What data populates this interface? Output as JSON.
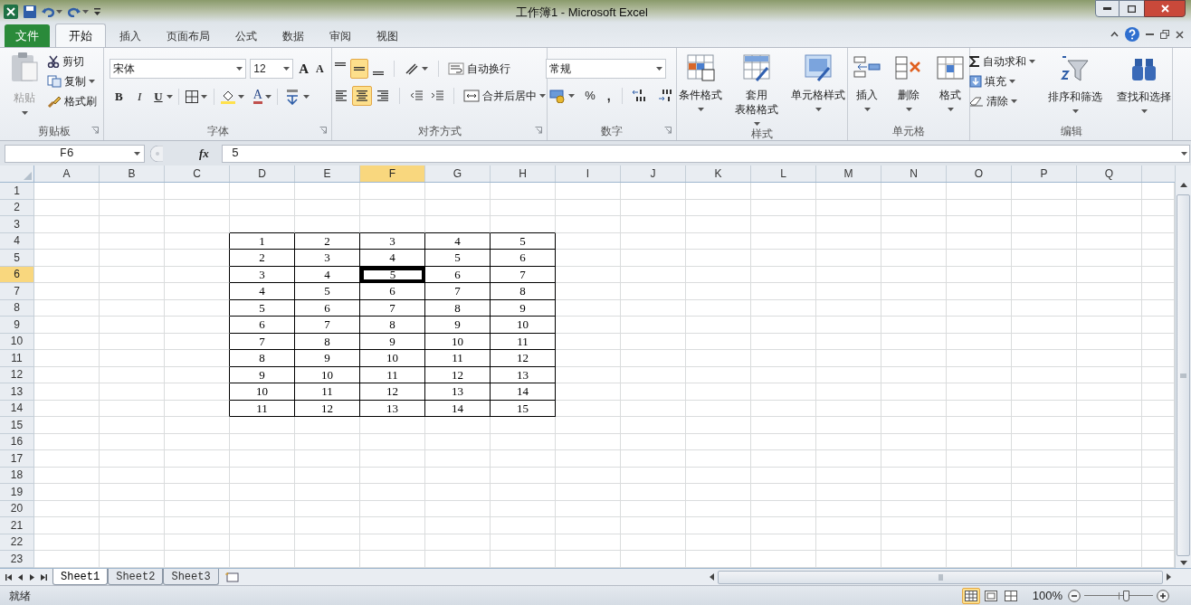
{
  "window": {
    "title": "工作簿1 - Microsoft Excel"
  },
  "ribbon_tabs": [
    {
      "label": "文件",
      "kind": "file",
      "selected": false
    },
    {
      "label": "开始",
      "kind": "tab",
      "selected": true
    },
    {
      "label": "插入",
      "kind": "tab",
      "selected": false
    },
    {
      "label": "页面布局",
      "kind": "tab",
      "selected": false
    },
    {
      "label": "公式",
      "kind": "tab",
      "selected": false
    },
    {
      "label": "数据",
      "kind": "tab",
      "selected": false
    },
    {
      "label": "审阅",
      "kind": "tab",
      "selected": false
    },
    {
      "label": "视图",
      "kind": "tab",
      "selected": false
    }
  ],
  "ribbon_groups": [
    {
      "kind": "clipboard",
      "label": "剪贴板",
      "paste": "粘贴",
      "items": [
        "剪切",
        "复制",
        "格式刷"
      ]
    },
    {
      "kind": "font",
      "label": "字体",
      "font": "宋体",
      "size": "12",
      "grow": "A",
      "shrink": "A",
      "bold": "B",
      "italic": "I",
      "underline": "U",
      "font_color": "A"
    },
    {
      "kind": "alignment",
      "label": "对齐方式",
      "vertical": [
        {
          "selected": false
        },
        {
          "selected": true
        },
        {
          "selected": false
        }
      ],
      "horizontal": [
        {
          "selected": false
        },
        {
          "selected": true
        },
        {
          "selected": false
        }
      ],
      "wrap": "自动换行",
      "merge": "合并后居中"
    },
    {
      "kind": "number",
      "label": "数字",
      "format": "常规",
      "percent": "%",
      "comma": ","
    },
    {
      "kind": "styles",
      "label": "样式",
      "buttons": [
        {
          "lines": [
            "条件格式"
          ]
        },
        {
          "lines": [
            "套用",
            "表格格式"
          ]
        },
        {
          "lines": [
            "单元格样式"
          ]
        }
      ]
    },
    {
      "kind": "cells",
      "label": "单元格",
      "buttons": [
        {
          "lines": [
            "插入"
          ]
        },
        {
          "lines": [
            "删除"
          ]
        },
        {
          "lines": [
            "格式"
          ]
        }
      ]
    },
    {
      "kind": "editing",
      "label": "编辑",
      "small": [
        "自动求和",
        "填充",
        "清除"
      ],
      "large": [
        {
          "lines": [
            "排序和筛选"
          ]
        },
        {
          "lines": [
            "查找和选择"
          ]
        }
      ]
    }
  ],
  "formula_bar": {
    "name_box": "F6",
    "fx": "fx",
    "formula": "5"
  },
  "columns": [
    {
      "label": "A",
      "selected": false
    },
    {
      "label": "B",
      "selected": false
    },
    {
      "label": "C",
      "selected": false
    },
    {
      "label": "D",
      "selected": false
    },
    {
      "label": "E",
      "selected": false
    },
    {
      "label": "F",
      "selected": true
    },
    {
      "label": "G",
      "selected": false
    },
    {
      "label": "H",
      "selected": false
    },
    {
      "label": "I",
      "selected": false
    },
    {
      "label": "J",
      "selected": false
    },
    {
      "label": "K",
      "selected": false
    },
    {
      "label": "L",
      "selected": false
    },
    {
      "label": "M",
      "selected": false
    },
    {
      "label": "N",
      "selected": false
    },
    {
      "label": "O",
      "selected": false
    },
    {
      "label": "P",
      "selected": false
    },
    {
      "label": "Q",
      "selected": false
    }
  ],
  "rows": [
    {
      "label": "1",
      "selected": false
    },
    {
      "label": "2",
      "selected": false
    },
    {
      "label": "3",
      "selected": false
    },
    {
      "label": "4",
      "selected": false
    },
    {
      "label": "5",
      "selected": false
    },
    {
      "label": "6",
      "selected": true
    },
    {
      "label": "7",
      "selected": false
    },
    {
      "label": "8",
      "selected": false
    },
    {
      "label": "9",
      "selected": false
    },
    {
      "label": "10",
      "selected": false
    },
    {
      "label": "11",
      "selected": false
    },
    {
      "label": "12",
      "selected": false
    },
    {
      "label": "13",
      "selected": false
    },
    {
      "label": "14",
      "selected": false
    },
    {
      "label": "15",
      "selected": false
    },
    {
      "label": "16",
      "selected": false
    },
    {
      "label": "17",
      "selected": false
    },
    {
      "label": "18",
      "selected": false
    },
    {
      "label": "19",
      "selected": false
    },
    {
      "label": "20",
      "selected": false
    },
    {
      "label": "21",
      "selected": false
    },
    {
      "label": "22",
      "selected": false
    },
    {
      "label": "23",
      "selected": false
    }
  ],
  "table": [
    [
      {
        "value": "1",
        "selected": false
      },
      {
        "value": "2",
        "selected": false
      },
      {
        "value": "3",
        "selected": false
      },
      {
        "value": "4",
        "selected": false
      },
      {
        "value": "5",
        "selected": false
      }
    ],
    [
      {
        "value": "2",
        "selected": false
      },
      {
        "value": "3",
        "selected": false
      },
      {
        "value": "4",
        "selected": false
      },
      {
        "value": "5",
        "selected": false
      },
      {
        "value": "6",
        "selected": false
      }
    ],
    [
      {
        "value": "3",
        "selected": false
      },
      {
        "value": "4",
        "selected": false
      },
      {
        "value": "5",
        "selected": true
      },
      {
        "value": "6",
        "selected": false
      },
      {
        "value": "7",
        "selected": false
      }
    ],
    [
      {
        "value": "4",
        "selected": false
      },
      {
        "value": "5",
        "selected": false
      },
      {
        "value": "6",
        "selected": false
      },
      {
        "value": "7",
        "selected": false
      },
      {
        "value": "8",
        "selected": false
      }
    ],
    [
      {
        "value": "5",
        "selected": false
      },
      {
        "value": "6",
        "selected": false
      },
      {
        "value": "7",
        "selected": false
      },
      {
        "value": "8",
        "selected": false
      },
      {
        "value": "9",
        "selected": false
      }
    ],
    [
      {
        "value": "6",
        "selected": false
      },
      {
        "value": "7",
        "selected": false
      },
      {
        "value": "8",
        "selected": false
      },
      {
        "value": "9",
        "selected": false
      },
      {
        "value": "10",
        "selected": false
      }
    ],
    [
      {
        "value": "7",
        "selected": false
      },
      {
        "value": "8",
        "selected": false
      },
      {
        "value": "9",
        "selected": false
      },
      {
        "value": "10",
        "selected": false
      },
      {
        "value": "11",
        "selected": false
      }
    ],
    [
      {
        "value": "8",
        "selected": false
      },
      {
        "value": "9",
        "selected": false
      },
      {
        "value": "10",
        "selected": false
      },
      {
        "value": "11",
        "selected": false
      },
      {
        "value": "12",
        "selected": false
      }
    ],
    [
      {
        "value": "9",
        "selected": false
      },
      {
        "value": "10",
        "selected": false
      },
      {
        "value": "11",
        "selected": false
      },
      {
        "value": "12",
        "selected": false
      },
      {
        "value": "13",
        "selected": false
      }
    ],
    [
      {
        "value": "10",
        "selected": false
      },
      {
        "value": "11",
        "selected": false
      },
      {
        "value": "12",
        "selected": false
      },
      {
        "value": "13",
        "selected": false
      },
      {
        "value": "14",
        "selected": false
      }
    ],
    [
      {
        "value": "11",
        "selected": false
      },
      {
        "value": "12",
        "selected": false
      },
      {
        "value": "13",
        "selected": false
      },
      {
        "value": "14",
        "selected": false
      },
      {
        "value": "15",
        "selected": false
      }
    ]
  ],
  "sheets": [
    {
      "label": "Sheet1",
      "selected": true
    },
    {
      "label": "Sheet2",
      "selected": false
    },
    {
      "label": "Sheet3",
      "selected": false
    }
  ],
  "status_bar": {
    "status": "就绪",
    "views": [
      {
        "selected": true
      },
      {
        "selected": false
      },
      {
        "selected": false
      }
    ],
    "zoom": "100%",
    "zoom_slider": {
      "level": 0.6
    }
  }
}
